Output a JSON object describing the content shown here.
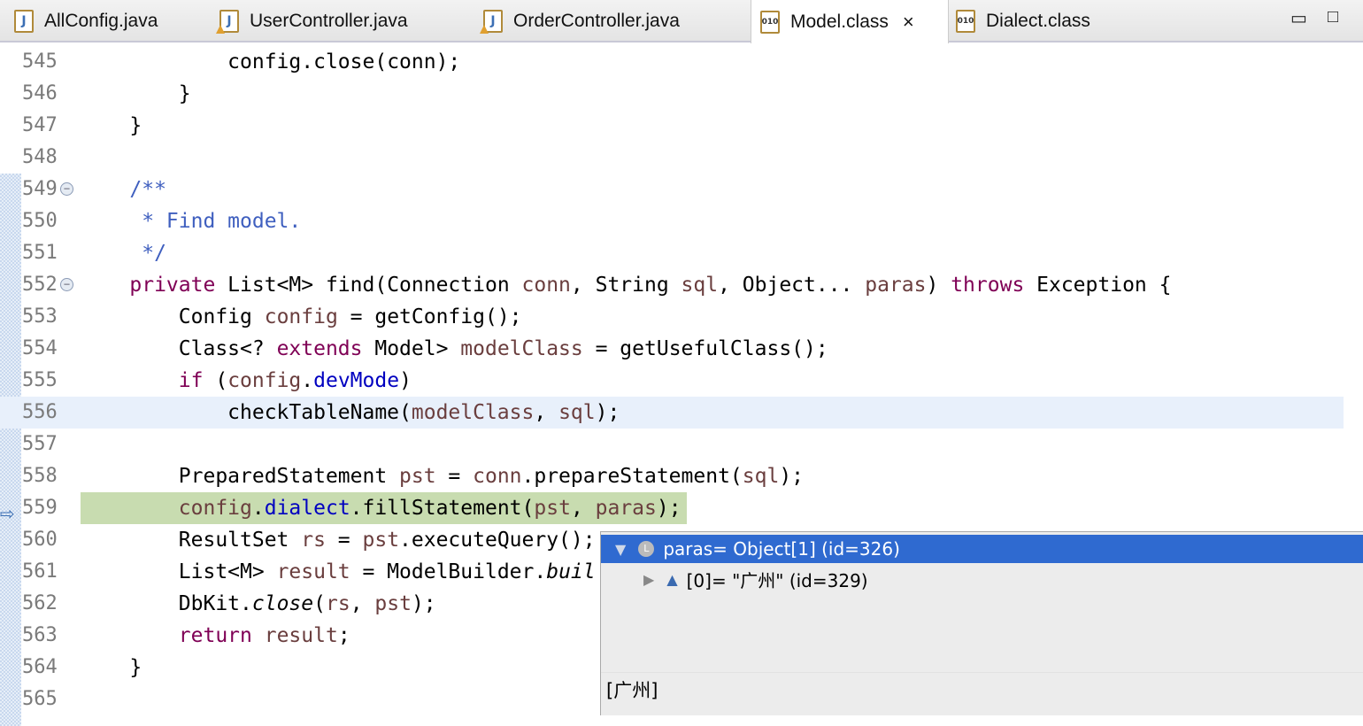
{
  "tabs": [
    {
      "label": "AllConfig.java",
      "icon": "java-file-icon",
      "warning": false
    },
    {
      "label": "UserController.java",
      "icon": "java-file-icon",
      "warning": true
    },
    {
      "label": "OrderController.java",
      "icon": "java-file-icon",
      "warning": true
    },
    {
      "label": "Model.class",
      "icon": "class-file-icon",
      "active": true,
      "close": "×"
    },
    {
      "label": "Dialect.class",
      "icon": "class-file-icon"
    }
  ],
  "window": {
    "minimize": "▭",
    "maximize": "□"
  },
  "lines": [
    {
      "n": "545",
      "t": [
        [
          "            config.",
          ""
        ],
        [
          "close(conn);",
          ""
        ]
      ]
    },
    {
      "n": "546",
      "t": [
        [
          "        }",
          ""
        ]
      ]
    },
    {
      "n": "547",
      "t": [
        [
          "    }",
          ""
        ]
      ]
    },
    {
      "n": "548",
      "t": []
    },
    {
      "n": "549",
      "fold": true,
      "t": [
        [
          "    /**",
          "cm"
        ]
      ]
    },
    {
      "n": "550",
      "t": [
        [
          "     * Find model.",
          "cm"
        ]
      ]
    },
    {
      "n": "551",
      "t": [
        [
          "     */",
          "cm"
        ]
      ]
    },
    {
      "n": "552",
      "fold": true,
      "t": [
        [
          "    ",
          ""
        ],
        [
          "private",
          "kw"
        ],
        [
          " List<M> find(Connection ",
          ""
        ],
        [
          "conn",
          "lv"
        ],
        [
          ", String ",
          ""
        ],
        [
          "sql",
          "lv"
        ],
        [
          ", Object... ",
          ""
        ],
        [
          "paras",
          "lv"
        ],
        [
          ") ",
          ""
        ],
        [
          "throws",
          "kw"
        ],
        [
          " Exception {",
          ""
        ]
      ]
    },
    {
      "n": "553",
      "t": [
        [
          "        Config ",
          ""
        ],
        [
          "config",
          "lv"
        ],
        [
          " = getConfig();",
          ""
        ]
      ]
    },
    {
      "n": "554",
      "t": [
        [
          "        Class<? ",
          ""
        ],
        [
          "extends",
          "kw"
        ],
        [
          " Model> ",
          ""
        ],
        [
          "modelClass",
          "lv"
        ],
        [
          " = getUsefulClass();",
          ""
        ]
      ]
    },
    {
      "n": "555",
      "t": [
        [
          "        ",
          ""
        ],
        [
          "if",
          "kw"
        ],
        [
          " (",
          ""
        ],
        [
          "config",
          "lv"
        ],
        [
          ".",
          ""
        ],
        [
          "devMode",
          "fd"
        ],
        [
          ")",
          ""
        ]
      ]
    },
    {
      "n": "556",
      "hl": true,
      "t": [
        [
          "            checkTableName(",
          ""
        ],
        [
          "modelClass",
          "lv"
        ],
        [
          ", ",
          ""
        ],
        [
          "sql",
          "lv"
        ],
        [
          ");",
          ""
        ]
      ]
    },
    {
      "n": "557",
      "t": []
    },
    {
      "n": "558",
      "t": [
        [
          "        PreparedStatement ",
          ""
        ],
        [
          "pst",
          "lv"
        ],
        [
          " = ",
          ""
        ],
        [
          "conn",
          "lv"
        ],
        [
          ".prepareStatement(",
          ""
        ],
        [
          "sql",
          "lv"
        ],
        [
          ");",
          ""
        ]
      ]
    },
    {
      "n": "559",
      "current": true,
      "t": [
        [
          "        ",
          ""
        ],
        [
          "config",
          "lv"
        ],
        [
          ".",
          ""
        ],
        [
          "dialect",
          "fd"
        ],
        [
          ".fillStatement(",
          ""
        ],
        [
          "pst",
          "lv"
        ],
        [
          ", ",
          ""
        ],
        [
          "paras",
          "lv"
        ],
        [
          ");",
          ""
        ]
      ]
    },
    {
      "n": "560",
      "t": [
        [
          "        ResultSet ",
          ""
        ],
        [
          "rs",
          "lv"
        ],
        [
          " = ",
          ""
        ],
        [
          "pst",
          "lv"
        ],
        [
          ".executeQuery();",
          ""
        ]
      ]
    },
    {
      "n": "561",
      "t": [
        [
          "        List<M> ",
          ""
        ],
        [
          "result",
          "lv"
        ],
        [
          " = ModelBuilder.",
          ""
        ],
        [
          "buil",
          "it"
        ]
      ]
    },
    {
      "n": "562",
      "t": [
        [
          "        DbKit.",
          ""
        ],
        [
          "close",
          "it"
        ],
        [
          "(",
          ""
        ],
        [
          "rs",
          "lv"
        ],
        [
          ", ",
          ""
        ],
        [
          "pst",
          "lv"
        ],
        [
          ");",
          ""
        ]
      ]
    },
    {
      "n": "563",
      "t": [
        [
          "        ",
          ""
        ],
        [
          "return",
          "kw"
        ],
        [
          " ",
          ""
        ],
        [
          "result",
          "lv"
        ],
        [
          ";",
          ""
        ]
      ]
    },
    {
      "n": "564",
      "t": [
        [
          "    }",
          ""
        ]
      ]
    },
    {
      "n": "565",
      "t": []
    }
  ],
  "popup": {
    "root": {
      "expander": "▼",
      "badge": "L",
      "label": "paras= Object[1]  (id=326)"
    },
    "child": {
      "expander": "▶",
      "label": "[0]= \"广州\" (id=329)"
    },
    "detail": "[广州]"
  },
  "colors": {
    "keyword": "#7f0055",
    "field": "#0000c0",
    "comment": "#3f5fbf",
    "local": "#6a3e3e",
    "current_line": "#c8dcb0",
    "selection": "#2f6ad0"
  }
}
